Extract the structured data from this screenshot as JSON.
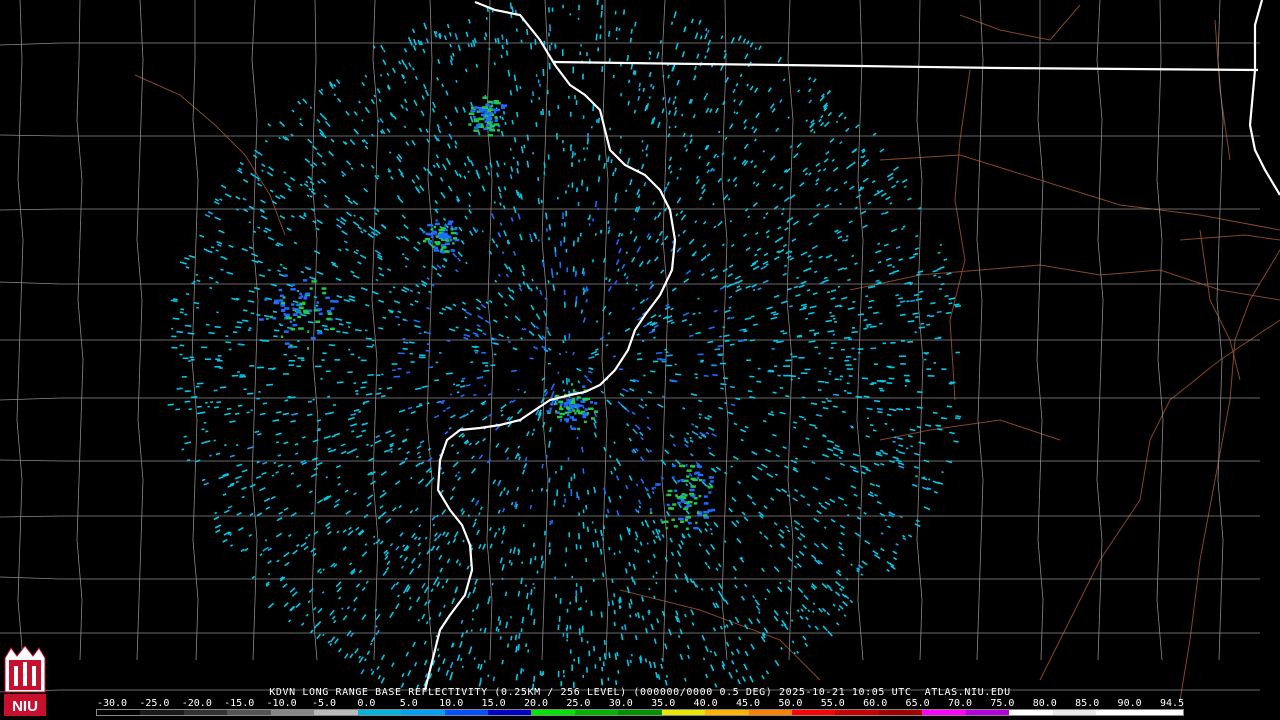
{
  "product": {
    "caption": "KDVN LONG RANGE BASE REFLECTIVITY (0.25KM / 256 LEVEL) (000000/0000 0.5 DEG) 2025-10-21 10:05 UTC  ATLAS.NIU.EDU"
  },
  "logo": {
    "text": "NIU",
    "primary_color": "#c8102e"
  },
  "scale": {
    "labels": [
      "-30.0",
      "-25.0",
      "-20.0",
      "-15.0",
      "-10.0",
      "-5.0",
      "0.0",
      "5.0",
      "10.0",
      "15.0",
      "20.0",
      "25.0",
      "30.0",
      "35.0",
      "40.0",
      "45.0",
      "50.0",
      "55.0",
      "60.0",
      "65.0",
      "70.0",
      "75.0",
      "80.0",
      "85.0",
      "90.0",
      "94.5"
    ],
    "colors": [
      "#000000",
      "#1a1a1a",
      "#333333",
      "#555555",
      "#888888",
      "#bbbbbb",
      "#00b4dc",
      "#00a0f5",
      "#0050ff",
      "#0000c8",
      "#00e400",
      "#00b400",
      "#009000",
      "#e8e800",
      "#ffb400",
      "#ff8000",
      "#ff0000",
      "#c80000",
      "#a00000",
      "#ff00ff",
      "#b400dc",
      "#ffffff",
      "#e8e8e8",
      "#ffffff",
      "#ffffff"
    ]
  },
  "legend_colors": {
    "background": "#000000",
    "county_lines": "#8a8a8a",
    "state_lines": "#ffffff",
    "roads": "#a0522d",
    "light_echo": "#00c8e6",
    "moderate_echo": "#1e6cff",
    "heavy_echo": "#22c84a"
  },
  "map": {
    "radar_site": "KDVN"
  }
}
